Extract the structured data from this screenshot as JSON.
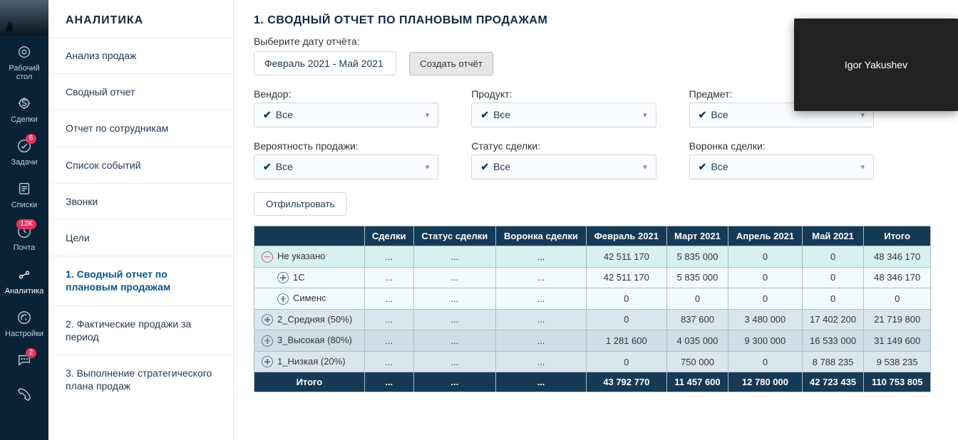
{
  "iconbar": {
    "items": [
      {
        "key": "desktop",
        "label": "Рабочий\nстол",
        "badge": ""
      },
      {
        "key": "deals",
        "label": "Сделки",
        "badge": ""
      },
      {
        "key": "tasks",
        "label": "Задачи",
        "badge": "6"
      },
      {
        "key": "lists",
        "label": "Списки",
        "badge": ""
      },
      {
        "key": "mail",
        "label": "Почта",
        "badge": "12K"
      },
      {
        "key": "analytics",
        "label": "Аналитика",
        "badge": ""
      },
      {
        "key": "settings",
        "label": "Настройки",
        "badge": ""
      },
      {
        "key": "chat",
        "label": "",
        "badge": "2"
      },
      {
        "key": "phone",
        "label": "",
        "badge": ""
      }
    ],
    "active": "analytics"
  },
  "sidebar": {
    "header": "АНАЛИТИКА",
    "items": [
      {
        "label": "Анализ продаж"
      },
      {
        "label": "Сводный отчет"
      },
      {
        "label": "Отчет по сотрудникам"
      },
      {
        "label": "Список событий"
      },
      {
        "label": "Звонки"
      },
      {
        "label": "Цели"
      },
      {
        "label": "1. Сводный отчет по плановым продажам",
        "active": true
      },
      {
        "label": "2. Фактические продажи за период"
      },
      {
        "label": "3. Выполнение стратегического плана продаж"
      }
    ]
  },
  "main": {
    "title": "1. СВОДНЫЙ ОТЧЕТ ПО ПЛАНОВЫМ ПРОДАЖАМ",
    "date_label": "Выберите дату отчёта:",
    "date_range": "Февраль 2021 - Май 2021",
    "create_btn": "Создать отчёт",
    "filter_btn": "Отфильтровать",
    "all": "Все",
    "filters": [
      {
        "label": "Вендор:"
      },
      {
        "label": "Продукт:"
      },
      {
        "label": "Предмет:"
      },
      {
        "label": "Вероятность продажи:"
      },
      {
        "label": "Статус сделки:"
      },
      {
        "label": "Воронка сделки:"
      }
    ]
  },
  "table": {
    "headers": [
      "",
      "Сделки",
      "Статус сделки",
      "Воронка сделки",
      "Февраль 2021",
      "Март 2021",
      "Апрель 2021",
      "Май 2021",
      "Итого"
    ],
    "rows": [
      {
        "class": "level0",
        "icon": "minus",
        "indent": 0,
        "label": "Не указано",
        "cells": [
          "...",
          "...",
          "...",
          "42 511 170",
          "5 835 000",
          "0",
          "0",
          "48 346 170"
        ]
      },
      {
        "class": "level1",
        "icon": "plus",
        "indent": 1,
        "label": "1С",
        "cells": [
          "...",
          "...",
          "...",
          "42 511 170",
          "5 835 000",
          "0",
          "0",
          "48 346 170"
        ]
      },
      {
        "class": "level1",
        "icon": "plus",
        "indent": 1,
        "label": "Сименс",
        "cells": [
          "...",
          "...",
          "...",
          "0",
          "0",
          "0",
          "0",
          "0"
        ]
      },
      {
        "class": "levelA",
        "icon": "plus",
        "indent": 0,
        "label": "2_Средняя (50%)",
        "cells": [
          "...",
          "...",
          "...",
          "0",
          "837 600",
          "3 480 000",
          "17 402 200",
          "21 719 800"
        ]
      },
      {
        "class": "levelB",
        "icon": "plus",
        "indent": 0,
        "label": "3_Высокая (80%)",
        "cells": [
          "...",
          "...",
          "...",
          "1 281 600",
          "4 035 000",
          "9 300 000",
          "16 533 000",
          "31 149 600"
        ]
      },
      {
        "class": "levelA",
        "icon": "plus",
        "indent": 0,
        "label": "1_Низкая (20%)",
        "cells": [
          "...",
          "...",
          "...",
          "0",
          "750 000",
          "0",
          "8 788 235",
          "9 538 235"
        ]
      }
    ],
    "footer": [
      "Итого",
      "...",
      "...",
      "...",
      "43 792 770",
      "11 457 600",
      "12 780 000",
      "42 723 435",
      "110 753 805"
    ]
  },
  "overlay": {
    "name": "Igor Yakushev"
  }
}
